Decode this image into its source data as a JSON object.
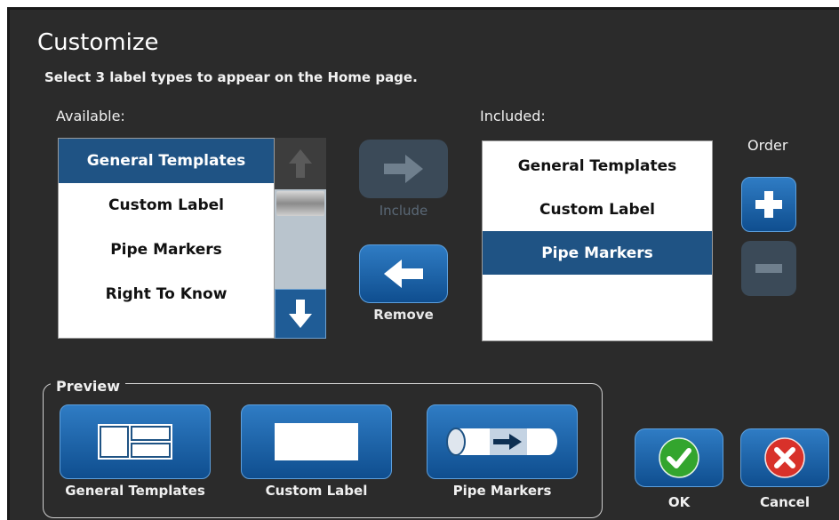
{
  "dialog": {
    "title": "Customize",
    "subtitle": "Select 3 label types to appear on the Home page."
  },
  "available": {
    "label": "Available:",
    "items": [
      {
        "label": "General Templates",
        "selected": true
      },
      {
        "label": "Custom Label",
        "selected": false
      },
      {
        "label": "Pipe Markers",
        "selected": false
      },
      {
        "label": "Right To Know",
        "selected": false
      }
    ]
  },
  "included": {
    "label": "Included:",
    "items": [
      {
        "label": "General Templates",
        "selected": false
      },
      {
        "label": "Custom Label",
        "selected": false
      },
      {
        "label": "Pipe Markers",
        "selected": true
      }
    ]
  },
  "actions": {
    "include_label": "Include",
    "include_enabled": false,
    "remove_label": "Remove",
    "remove_enabled": true
  },
  "order": {
    "label": "Order",
    "up_enabled": true,
    "down_enabled": false
  },
  "preview": {
    "legend": "Preview",
    "items": [
      {
        "label": "General Templates",
        "icon": "general-templates-icon"
      },
      {
        "label": "Custom Label",
        "icon": "custom-label-icon"
      },
      {
        "label": "Pipe Markers",
        "icon": "pipe-marker-icon"
      }
    ]
  },
  "footer": {
    "ok_label": "OK",
    "cancel_label": "Cancel"
  },
  "colors": {
    "background": "#2b2b2b",
    "selection": "#1f5384",
    "button_blue": "#1f64a8",
    "ok_green": "#33a52e",
    "cancel_red": "#d8312a"
  }
}
